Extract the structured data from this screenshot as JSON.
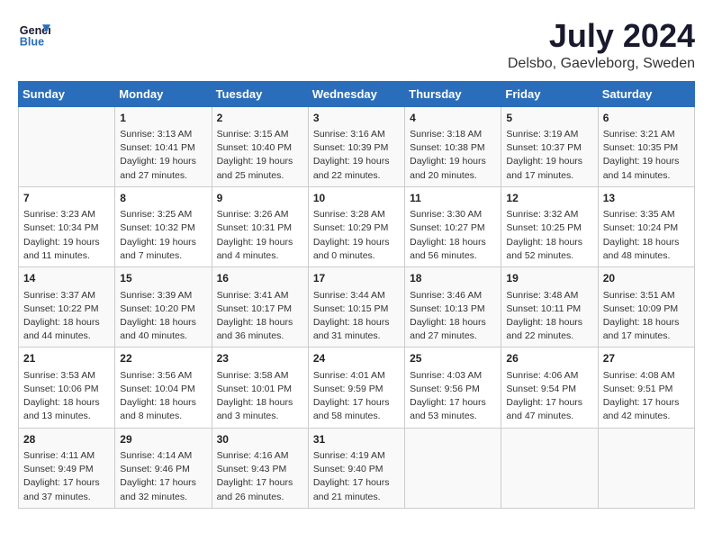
{
  "header": {
    "logo_line1": "General",
    "logo_line2": "Blue",
    "month_year": "July 2024",
    "location": "Delsbo, Gaevleborg, Sweden"
  },
  "weekdays": [
    "Sunday",
    "Monday",
    "Tuesday",
    "Wednesday",
    "Thursday",
    "Friday",
    "Saturday"
  ],
  "weeks": [
    [
      {
        "day": "",
        "info": ""
      },
      {
        "day": "1",
        "info": "Sunrise: 3:13 AM\nSunset: 10:41 PM\nDaylight: 19 hours\nand 27 minutes."
      },
      {
        "day": "2",
        "info": "Sunrise: 3:15 AM\nSunset: 10:40 PM\nDaylight: 19 hours\nand 25 minutes."
      },
      {
        "day": "3",
        "info": "Sunrise: 3:16 AM\nSunset: 10:39 PM\nDaylight: 19 hours\nand 22 minutes."
      },
      {
        "day": "4",
        "info": "Sunrise: 3:18 AM\nSunset: 10:38 PM\nDaylight: 19 hours\nand 20 minutes."
      },
      {
        "day": "5",
        "info": "Sunrise: 3:19 AM\nSunset: 10:37 PM\nDaylight: 19 hours\nand 17 minutes."
      },
      {
        "day": "6",
        "info": "Sunrise: 3:21 AM\nSunset: 10:35 PM\nDaylight: 19 hours\nand 14 minutes."
      }
    ],
    [
      {
        "day": "7",
        "info": "Sunrise: 3:23 AM\nSunset: 10:34 PM\nDaylight: 19 hours\nand 11 minutes."
      },
      {
        "day": "8",
        "info": "Sunrise: 3:25 AM\nSunset: 10:32 PM\nDaylight: 19 hours\nand 7 minutes."
      },
      {
        "day": "9",
        "info": "Sunrise: 3:26 AM\nSunset: 10:31 PM\nDaylight: 19 hours\nand 4 minutes."
      },
      {
        "day": "10",
        "info": "Sunrise: 3:28 AM\nSunset: 10:29 PM\nDaylight: 19 hours\nand 0 minutes."
      },
      {
        "day": "11",
        "info": "Sunrise: 3:30 AM\nSunset: 10:27 PM\nDaylight: 18 hours\nand 56 minutes."
      },
      {
        "day": "12",
        "info": "Sunrise: 3:32 AM\nSunset: 10:25 PM\nDaylight: 18 hours\nand 52 minutes."
      },
      {
        "day": "13",
        "info": "Sunrise: 3:35 AM\nSunset: 10:24 PM\nDaylight: 18 hours\nand 48 minutes."
      }
    ],
    [
      {
        "day": "14",
        "info": "Sunrise: 3:37 AM\nSunset: 10:22 PM\nDaylight: 18 hours\nand 44 minutes."
      },
      {
        "day": "15",
        "info": "Sunrise: 3:39 AM\nSunset: 10:20 PM\nDaylight: 18 hours\nand 40 minutes."
      },
      {
        "day": "16",
        "info": "Sunrise: 3:41 AM\nSunset: 10:17 PM\nDaylight: 18 hours\nand 36 minutes."
      },
      {
        "day": "17",
        "info": "Sunrise: 3:44 AM\nSunset: 10:15 PM\nDaylight: 18 hours\nand 31 minutes."
      },
      {
        "day": "18",
        "info": "Sunrise: 3:46 AM\nSunset: 10:13 PM\nDaylight: 18 hours\nand 27 minutes."
      },
      {
        "day": "19",
        "info": "Sunrise: 3:48 AM\nSunset: 10:11 PM\nDaylight: 18 hours\nand 22 minutes."
      },
      {
        "day": "20",
        "info": "Sunrise: 3:51 AM\nSunset: 10:09 PM\nDaylight: 18 hours\nand 17 minutes."
      }
    ],
    [
      {
        "day": "21",
        "info": "Sunrise: 3:53 AM\nSunset: 10:06 PM\nDaylight: 18 hours\nand 13 minutes."
      },
      {
        "day": "22",
        "info": "Sunrise: 3:56 AM\nSunset: 10:04 PM\nDaylight: 18 hours\nand 8 minutes."
      },
      {
        "day": "23",
        "info": "Sunrise: 3:58 AM\nSunset: 10:01 PM\nDaylight: 18 hours\nand 3 minutes."
      },
      {
        "day": "24",
        "info": "Sunrise: 4:01 AM\nSunset: 9:59 PM\nDaylight: 17 hours\nand 58 minutes."
      },
      {
        "day": "25",
        "info": "Sunrise: 4:03 AM\nSunset: 9:56 PM\nDaylight: 17 hours\nand 53 minutes."
      },
      {
        "day": "26",
        "info": "Sunrise: 4:06 AM\nSunset: 9:54 PM\nDaylight: 17 hours\nand 47 minutes."
      },
      {
        "day": "27",
        "info": "Sunrise: 4:08 AM\nSunset: 9:51 PM\nDaylight: 17 hours\nand 42 minutes."
      }
    ],
    [
      {
        "day": "28",
        "info": "Sunrise: 4:11 AM\nSunset: 9:49 PM\nDaylight: 17 hours\nand 37 minutes."
      },
      {
        "day": "29",
        "info": "Sunrise: 4:14 AM\nSunset: 9:46 PM\nDaylight: 17 hours\nand 32 minutes."
      },
      {
        "day": "30",
        "info": "Sunrise: 4:16 AM\nSunset: 9:43 PM\nDaylight: 17 hours\nand 26 minutes."
      },
      {
        "day": "31",
        "info": "Sunrise: 4:19 AM\nSunset: 9:40 PM\nDaylight: 17 hours\nand 21 minutes."
      },
      {
        "day": "",
        "info": ""
      },
      {
        "day": "",
        "info": ""
      },
      {
        "day": "",
        "info": ""
      }
    ]
  ]
}
